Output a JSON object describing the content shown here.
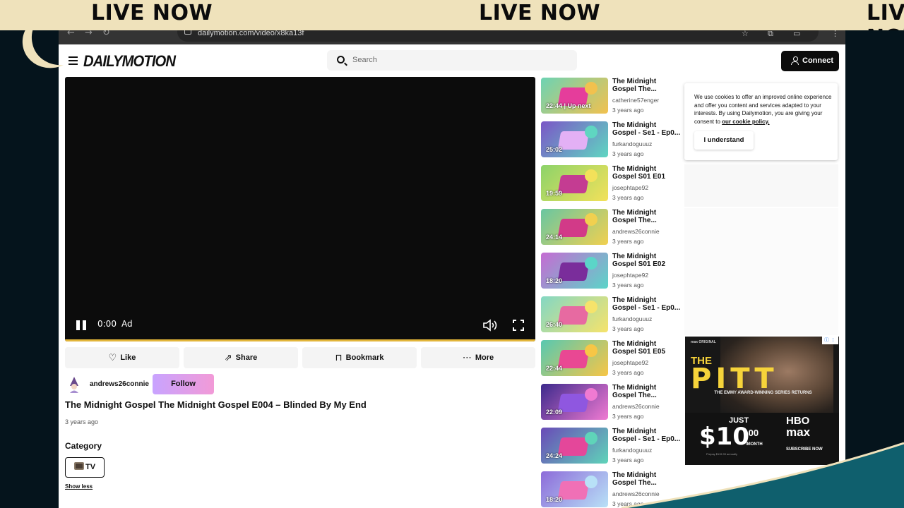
{
  "banner": {
    "text": "LIVE NOW"
  },
  "browser": {
    "url": "dailymotion.com/video/x8ka13f"
  },
  "site": {
    "logo": "DAILYMOTION",
    "search_placeholder": "Search",
    "connect_label": "Connect"
  },
  "player": {
    "time": "0:00",
    "ad_label": "Ad",
    "progress": 1.0
  },
  "actions": {
    "like": "Like",
    "share": "Share",
    "bookmark": "Bookmark",
    "more": "More"
  },
  "channel": {
    "name": "andrews26connie",
    "follow_label": "Follow"
  },
  "video": {
    "title": "The Midnight Gospel The Midnight Gospel E004 – Blinded By My End",
    "date": "3 years ago",
    "category_heading": "Category",
    "category": "TV",
    "show_less": "Show less"
  },
  "up_next": [
    {
      "title": "The Midnight Gospel The...",
      "user": "catherine57enger",
      "age": "3 years ago",
      "duration": "22:44 | Up next",
      "colors": [
        "#6cd3b4",
        "#e53d9b",
        "#f2c14e"
      ]
    },
    {
      "title": "The Midnight Gospel - Se1 - Ep0...",
      "user": "furkandoguuuz",
      "age": "3 years ago",
      "duration": "25:02",
      "colors": [
        "#7b56c7",
        "#e3b0f5",
        "#5fd6c1"
      ]
    },
    {
      "title": "The Midnight Gospel S01 E01",
      "user": "josephtape92",
      "age": "3 years ago",
      "duration": "19:59",
      "colors": [
        "#8cd36a",
        "#c43c92",
        "#f3e15a"
      ]
    },
    {
      "title": "The Midnight Gospel The...",
      "user": "andrews26connie",
      "age": "3 years ago",
      "duration": "24:14",
      "colors": [
        "#68c6a2",
        "#d23a88",
        "#f1d04f"
      ]
    },
    {
      "title": "The Midnight Gospel S01 E02",
      "user": "josephtape92",
      "age": "3 years ago",
      "duration": "18:20",
      "colors": [
        "#c66bd3",
        "#7a2d9b",
        "#5bd5c8"
      ]
    },
    {
      "title": "The Midnight Gospel - Se1 - Ep0...",
      "user": "furkandoguuuz",
      "age": "3 years ago",
      "duration": "26:40",
      "colors": [
        "#83d7c4",
        "#e76aa1",
        "#f6e36b"
      ]
    },
    {
      "title": "The Midnight Gospel S01 E05",
      "user": "josephtape92",
      "age": "3 years ago",
      "duration": "22:44",
      "colors": [
        "#57c8b1",
        "#e94893",
        "#f7c646"
      ]
    },
    {
      "title": "The Midnight Gospel The...",
      "user": "andrews26connie",
      "age": "3 years ago",
      "duration": "22:09",
      "colors": [
        "#3c2a8c",
        "#8f57e0",
        "#f07ad2"
      ]
    },
    {
      "title": "The Midnight Gospel - Se1 - Ep0...",
      "user": "furkandoguuuz",
      "age": "3 years ago",
      "duration": "24:24",
      "colors": [
        "#6a4ab8",
        "#e4479a",
        "#5fd4b9"
      ]
    },
    {
      "title": "The Midnight Gospel The...",
      "user": "andrews26connie",
      "age": "3 years ago",
      "duration": "18:20",
      "colors": [
        "#8d6bd9",
        "#f070b6",
        "#b8e1f7"
      ]
    }
  ],
  "cookie": {
    "text": "We use cookies to offer an improved online experience and offer you content and services adapted to your interests. By using Dailymotion, you are giving your consent to",
    "link": "our cookie policy.",
    "button": "I understand"
  },
  "ad": {
    "brand": "max ORIGINAL",
    "the": "THE",
    "pitt": "PITT",
    "tagline": "THE EMMY AWARD-WINNING SERIES RETURNS",
    "just": "JUST",
    "price": "$10",
    "cents": ".00",
    "per": "/MONTH",
    "prepay": "Prepay $119.99 annually",
    "hbo": "HBO",
    "max": "max",
    "cta": "SUBSCRIBE NOW",
    "badge": "ⓘ ⋮"
  },
  "colors": {
    "background": "#05141c",
    "banner": "#efe2bb",
    "teal": "#0f5f6d",
    "follow_gradient": [
      "#c8a3ff",
      "#f29ad7"
    ],
    "progress": "#e2b53a"
  }
}
